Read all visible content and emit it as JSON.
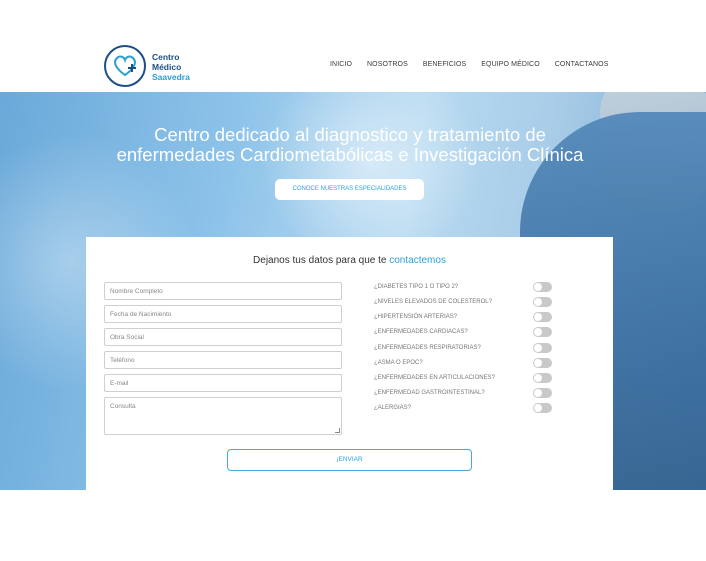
{
  "brand": {
    "line1": "Centro",
    "line2": "Médico",
    "line3": "Saavedra",
    "colors": {
      "primary": "#1c4f8a",
      "accent": "#2aa3d8"
    }
  },
  "nav": {
    "items": [
      "INICIO",
      "NOSOTROS",
      "BENEFICIOS",
      "EQUIPO MÉDICO",
      "CONTACTANOS"
    ]
  },
  "hero": {
    "line1": "Centro dedicado al diagnostico y tratamiento de",
    "line2": "enfermedades Cardiometabólicas e Investigación Clínica",
    "cta": "CONOCE NUESTRAS ESPECIALIDADES"
  },
  "form": {
    "title_main": "Dejanos tus datos para que te ",
    "title_accent": "contactemos",
    "fields": [
      {
        "placeholder": "Nombre Completo"
      },
      {
        "placeholder": "Fecha de Nacimiento"
      },
      {
        "placeholder": "Obra Social"
      },
      {
        "placeholder": "Teléfono"
      },
      {
        "placeholder": "E-mail"
      },
      {
        "placeholder": "Consulta"
      }
    ],
    "questions": [
      {
        "label": "¿DIABETES TIPO 1 O TIPO 2?",
        "on": false
      },
      {
        "label": "¿NIVELES ELEVADOS DE COLESTEROL?",
        "on": false
      },
      {
        "label": "¿HIPERTENSIÓN ARTERIAS?",
        "on": false
      },
      {
        "label": "¿ENFERMEDADES CARDIACAS?",
        "on": false
      },
      {
        "label": "¿ENFERMEDADES RESPIRATORIAS?",
        "on": false
      },
      {
        "label": "¿ASMA O EPOC?",
        "on": false
      },
      {
        "label": "¿ENFERMEDADES EN ARTICULACIONES?",
        "on": false
      },
      {
        "label": "¿ENFERMEDAD GASTROINTESTINAL?",
        "on": false
      },
      {
        "label": "¿ALERGIAS?",
        "on": false
      }
    ],
    "submit": "¡ENVIAR"
  }
}
